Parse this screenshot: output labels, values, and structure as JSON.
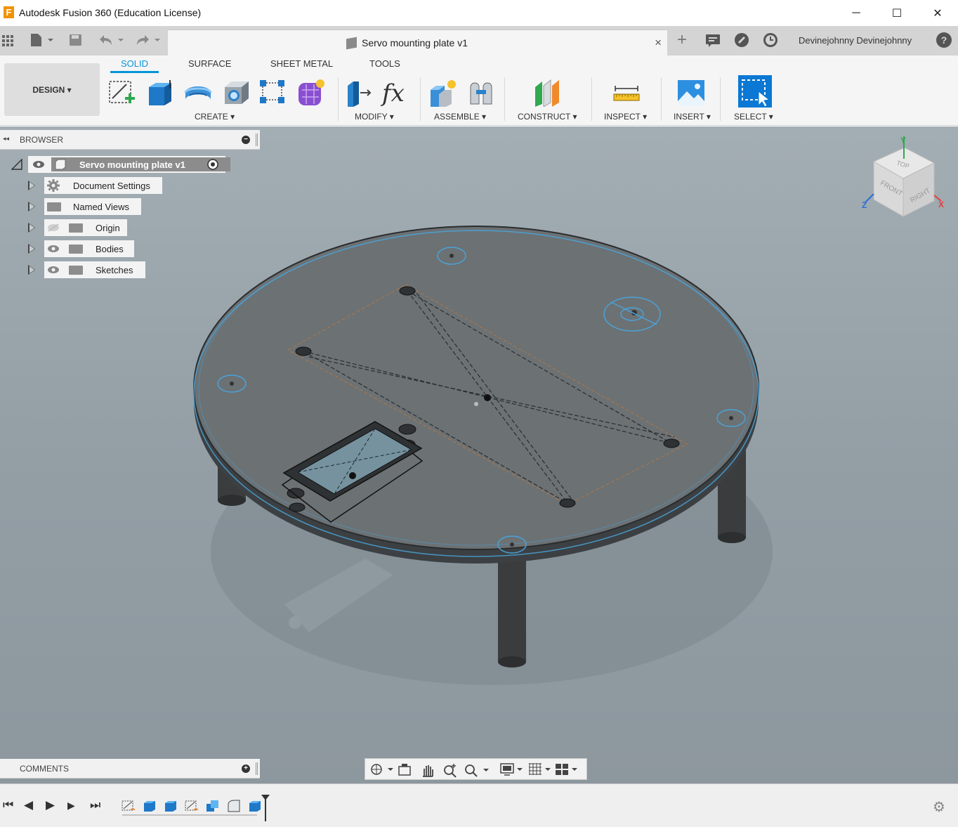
{
  "window": {
    "title": "Autodesk Fusion 360 (Education License)",
    "logo_letter": "F",
    "minimize": "─",
    "maximize": "☐",
    "close": "✕"
  },
  "qat": {
    "grid_icon": "grid-icon",
    "file_icon": "file-icon",
    "save_icon": "save-icon",
    "undo_icon": "undo-icon",
    "redo_icon": "redo-icon"
  },
  "document_tab": {
    "title": "Servo mounting plate v1",
    "close": "×"
  },
  "header_right": {
    "new_tab": "+",
    "user": "Devinejohnny Devinejohnny",
    "help": "?"
  },
  "ribbon": {
    "workspace_button": "DESIGN ▾",
    "tabs": [
      {
        "label": "SOLID",
        "active": true
      },
      {
        "label": "SURFACE",
        "active": false
      },
      {
        "label": "SHEET METAL",
        "active": false
      },
      {
        "label": "TOOLS",
        "active": false
      }
    ],
    "groups": [
      {
        "label": "CREATE ▾"
      },
      {
        "label": "MODIFY ▾"
      },
      {
        "label": "ASSEMBLE ▾"
      },
      {
        "label": "CONSTRUCT ▾"
      },
      {
        "label": "INSPECT ▾"
      },
      {
        "label": "INSERT ▾"
      },
      {
        "label": "SELECT ▾"
      }
    ],
    "accent_color": "#0696d7"
  },
  "browser": {
    "title": "BROWSER",
    "collapse": "◂◂",
    "root": "Servo mounting plate v1",
    "items": [
      {
        "label": "Document Settings"
      },
      {
        "label": "Named Views"
      },
      {
        "label": "Origin"
      },
      {
        "label": "Bodies"
      },
      {
        "label": "Sketches"
      }
    ]
  },
  "viewcube": {
    "top": "TOP",
    "front": "FRONT",
    "right": "RIGHT",
    "axis_x": "X",
    "axis_y": "Y",
    "axis_z": "Z"
  },
  "comments": {
    "title": "COMMENTS"
  },
  "nav_toolbar": {
    "orbit": "orbit-icon",
    "look_at": "look-at-icon",
    "pan": "pan-icon",
    "zoom": "zoom-icon",
    "fit": "zoom-window-icon",
    "display": "display-settings-icon",
    "grid": "grid-settings-icon",
    "viewports": "viewports-icon"
  },
  "timeline": {
    "first": "⏮",
    "prev": "◀",
    "play": "▶",
    "next": "▶",
    "last": "⏭",
    "settings": "⚙"
  }
}
